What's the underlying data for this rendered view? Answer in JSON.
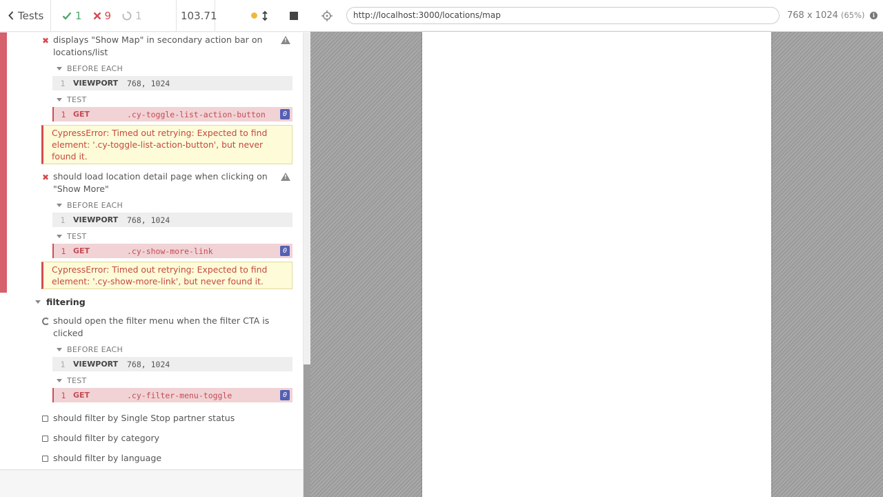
{
  "header": {
    "tests_label": "Tests",
    "passed_count": "1",
    "failed_count": "9",
    "pending_count": "1",
    "duration": "103.71"
  },
  "url_bar": {
    "url": "http://localhost:3000/locations/map",
    "viewport": "768 x 1024",
    "zoom": "(65%)"
  },
  "tests": [
    {
      "title_line1": "displays \"Show Map\" in secondary action bar on",
      "title_line2": "locations/list",
      "before_each_label": "BEFORE EACH",
      "before_cmd": {
        "num": "1",
        "name": "VIEWPORT",
        "msg": "768, 1024"
      },
      "test_label": "TEST",
      "test_cmd": {
        "num": "1",
        "name": "GET",
        "msg": ".cy-toggle-list-action-button",
        "badge": "0"
      },
      "error_lines": [
        "CypressError: Timed out retrying: Expected to find",
        "element: '.cy-toggle-list-action-button', but never",
        "found it."
      ]
    },
    {
      "title_line1": "should load location detail page when clicking on",
      "title_line2": "\"Show More\"",
      "before_each_label": "BEFORE EACH",
      "before_cmd": {
        "num": "1",
        "name": "VIEWPORT",
        "msg": "768, 1024"
      },
      "test_label": "TEST",
      "test_cmd": {
        "num": "1",
        "name": "GET",
        "msg": ".cy-show-more-link",
        "badge": "0"
      },
      "error_lines": [
        "CypressError: Timed out retrying: Expected to find",
        "element: '.cy-show-more-link', but never found it."
      ]
    }
  ],
  "suite": {
    "title": "filtering",
    "running_test": {
      "title_line1": "should open the filter menu when the filter CTA is",
      "title_line2": "clicked",
      "before_each_label": "BEFORE EACH",
      "before_cmd": {
        "num": "1",
        "name": "VIEWPORT",
        "msg": "768, 1024"
      },
      "test_label": "TEST",
      "test_cmd": {
        "num": "1",
        "name": "GET",
        "msg": ".cy-filter-menu-toggle",
        "badge": "0"
      }
    },
    "pending_tests": [
      "should filter by Single Stop partner status",
      "should filter by category",
      "should filter by language"
    ]
  },
  "colors": {
    "fail": "#d24b51",
    "pass": "#4ea76b",
    "badge": "#5460b4",
    "error_bg": "#fdfbd8"
  }
}
